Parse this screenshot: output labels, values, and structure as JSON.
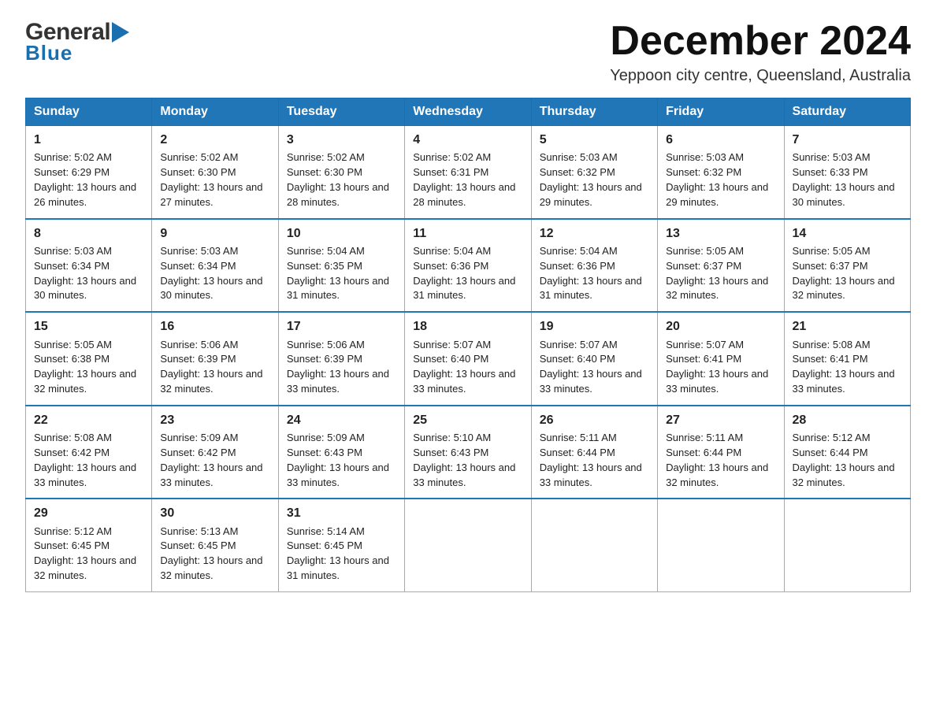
{
  "logo": {
    "general": "General",
    "arrow": "▶",
    "blue": "Blue"
  },
  "title": "December 2024",
  "subtitle": "Yeppoon city centre, Queensland, Australia",
  "weekdays": [
    "Sunday",
    "Monday",
    "Tuesday",
    "Wednesday",
    "Thursday",
    "Friday",
    "Saturday"
  ],
  "weeks": [
    [
      {
        "day": 1,
        "sunrise": "5:02 AM",
        "sunset": "6:29 PM",
        "daylight": "13 hours and 26 minutes."
      },
      {
        "day": 2,
        "sunrise": "5:02 AM",
        "sunset": "6:30 PM",
        "daylight": "13 hours and 27 minutes."
      },
      {
        "day": 3,
        "sunrise": "5:02 AM",
        "sunset": "6:30 PM",
        "daylight": "13 hours and 28 minutes."
      },
      {
        "day": 4,
        "sunrise": "5:02 AM",
        "sunset": "6:31 PM",
        "daylight": "13 hours and 28 minutes."
      },
      {
        "day": 5,
        "sunrise": "5:03 AM",
        "sunset": "6:32 PM",
        "daylight": "13 hours and 29 minutes."
      },
      {
        "day": 6,
        "sunrise": "5:03 AM",
        "sunset": "6:32 PM",
        "daylight": "13 hours and 29 minutes."
      },
      {
        "day": 7,
        "sunrise": "5:03 AM",
        "sunset": "6:33 PM",
        "daylight": "13 hours and 30 minutes."
      }
    ],
    [
      {
        "day": 8,
        "sunrise": "5:03 AM",
        "sunset": "6:34 PM",
        "daylight": "13 hours and 30 minutes."
      },
      {
        "day": 9,
        "sunrise": "5:03 AM",
        "sunset": "6:34 PM",
        "daylight": "13 hours and 30 minutes."
      },
      {
        "day": 10,
        "sunrise": "5:04 AM",
        "sunset": "6:35 PM",
        "daylight": "13 hours and 31 minutes."
      },
      {
        "day": 11,
        "sunrise": "5:04 AM",
        "sunset": "6:36 PM",
        "daylight": "13 hours and 31 minutes."
      },
      {
        "day": 12,
        "sunrise": "5:04 AM",
        "sunset": "6:36 PM",
        "daylight": "13 hours and 31 minutes."
      },
      {
        "day": 13,
        "sunrise": "5:05 AM",
        "sunset": "6:37 PM",
        "daylight": "13 hours and 32 minutes."
      },
      {
        "day": 14,
        "sunrise": "5:05 AM",
        "sunset": "6:37 PM",
        "daylight": "13 hours and 32 minutes."
      }
    ],
    [
      {
        "day": 15,
        "sunrise": "5:05 AM",
        "sunset": "6:38 PM",
        "daylight": "13 hours and 32 minutes."
      },
      {
        "day": 16,
        "sunrise": "5:06 AM",
        "sunset": "6:39 PM",
        "daylight": "13 hours and 32 minutes."
      },
      {
        "day": 17,
        "sunrise": "5:06 AM",
        "sunset": "6:39 PM",
        "daylight": "13 hours and 33 minutes."
      },
      {
        "day": 18,
        "sunrise": "5:07 AM",
        "sunset": "6:40 PM",
        "daylight": "13 hours and 33 minutes."
      },
      {
        "day": 19,
        "sunrise": "5:07 AM",
        "sunset": "6:40 PM",
        "daylight": "13 hours and 33 minutes."
      },
      {
        "day": 20,
        "sunrise": "5:07 AM",
        "sunset": "6:41 PM",
        "daylight": "13 hours and 33 minutes."
      },
      {
        "day": 21,
        "sunrise": "5:08 AM",
        "sunset": "6:41 PM",
        "daylight": "13 hours and 33 minutes."
      }
    ],
    [
      {
        "day": 22,
        "sunrise": "5:08 AM",
        "sunset": "6:42 PM",
        "daylight": "13 hours and 33 minutes."
      },
      {
        "day": 23,
        "sunrise": "5:09 AM",
        "sunset": "6:42 PM",
        "daylight": "13 hours and 33 minutes."
      },
      {
        "day": 24,
        "sunrise": "5:09 AM",
        "sunset": "6:43 PM",
        "daylight": "13 hours and 33 minutes."
      },
      {
        "day": 25,
        "sunrise": "5:10 AM",
        "sunset": "6:43 PM",
        "daylight": "13 hours and 33 minutes."
      },
      {
        "day": 26,
        "sunrise": "5:11 AM",
        "sunset": "6:44 PM",
        "daylight": "13 hours and 33 minutes."
      },
      {
        "day": 27,
        "sunrise": "5:11 AM",
        "sunset": "6:44 PM",
        "daylight": "13 hours and 32 minutes."
      },
      {
        "day": 28,
        "sunrise": "5:12 AM",
        "sunset": "6:44 PM",
        "daylight": "13 hours and 32 minutes."
      }
    ],
    [
      {
        "day": 29,
        "sunrise": "5:12 AM",
        "sunset": "6:45 PM",
        "daylight": "13 hours and 32 minutes."
      },
      {
        "day": 30,
        "sunrise": "5:13 AM",
        "sunset": "6:45 PM",
        "daylight": "13 hours and 32 minutes."
      },
      {
        "day": 31,
        "sunrise": "5:14 AM",
        "sunset": "6:45 PM",
        "daylight": "13 hours and 31 minutes."
      },
      null,
      null,
      null,
      null
    ]
  ],
  "labels": {
    "sunrise": "Sunrise:",
    "sunset": "Sunset:",
    "daylight": "Daylight:"
  }
}
